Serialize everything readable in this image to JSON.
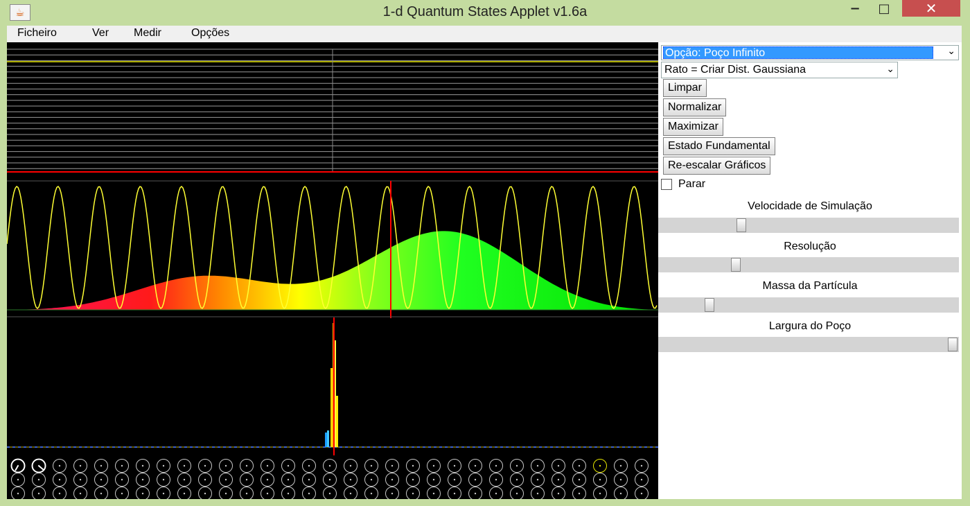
{
  "window": {
    "title": "1-d Quantum States Applet v1.6a",
    "minimize_glyph": "−",
    "maximize_glyph": "□",
    "close_glyph": "✕",
    "icon_glyph": "☕"
  },
  "menu": {
    "items": [
      "Ficheiro",
      "Ver",
      "Medir",
      "Opções"
    ]
  },
  "controls": {
    "option_select": "Opção: Poço Infinito",
    "mouse_select": "Rato = Criar Dist. Gaussiana",
    "buttons": [
      "Limpar",
      "Normalizar",
      "Maximizar",
      "Estado Fundamental",
      "Re-escalar Gráficos"
    ],
    "stop_checkbox_label": "Parar",
    "stop_checked": false,
    "sliders": [
      {
        "label": "Velocidade de Simulação",
        "level": 0.27
      },
      {
        "label": "Resolução",
        "level": 0.25
      },
      {
        "label": "Massa da Partícula",
        "level": 0.16
      },
      {
        "label": "Largura do Poço",
        "level": 1.0
      }
    ]
  },
  "colors": {
    "title_bg": "#c4dca0",
    "close_bg": "#c74f4f",
    "selection_bg": "#3399ff",
    "sim_bg": "#000000",
    "potential_line": "#e6e600",
    "marker_line": "#ff0000",
    "wave_line": "#ffff33",
    "phasor_circle": "#c8c8c8"
  }
}
